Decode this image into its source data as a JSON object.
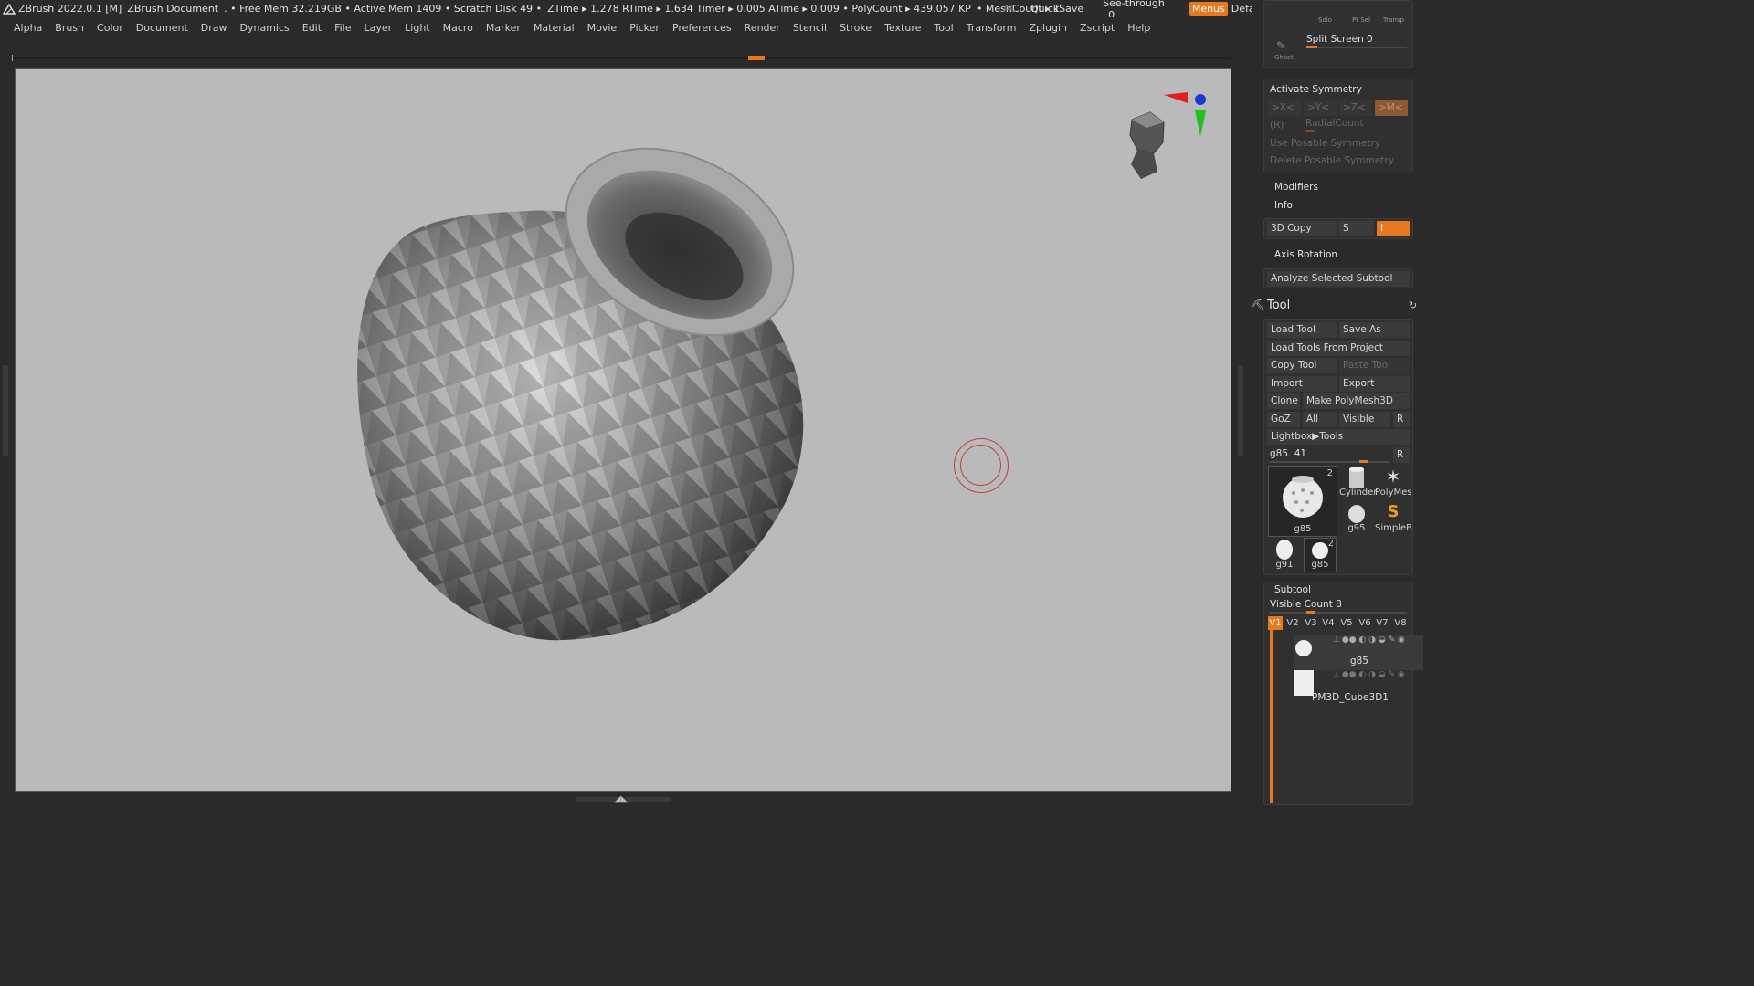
{
  "titlebar": {
    "app": "ZBrush 2022.0.1 [M]",
    "document": "ZBrush Document",
    "stats": [
      ". • Free Mem 32.219GB • Active Mem 1409 • Scratch Disk 49 •",
      "ZTime ▸ 1.278 RTime ▸ 1.634 Timer ▸ 0.005 ATime ▸ 0.009 • PolyCount ▸ 439.057 KP",
      "• MeshCount ▸ 1"
    ],
    "ac": "AC",
    "quicksave": "QuickSave",
    "see_through": "See-through",
    "see_through_value": "0",
    "menus": "Menus",
    "zscript": "DefaultZScript"
  },
  "menubar": [
    "Alpha",
    "Brush",
    "Color",
    "Document",
    "Draw",
    "Dynamics",
    "Edit",
    "File",
    "Layer",
    "Light",
    "Macro",
    "Marker",
    "Material",
    "Movie",
    "Picker",
    "Preferences",
    "Render",
    "Stencil",
    "Stroke",
    "Texture",
    "Tool",
    "Transform",
    "Zplugin",
    "Zscript",
    "Help"
  ],
  "colors": {
    "accent": "#e8781e",
    "canvas": "#bababa",
    "panel": "#2a2a2a"
  },
  "rpanel": {
    "top_icons": {
      "solo": "Solo",
      "ptsel": "Pt Sel",
      "transp": "Transp",
      "ghost": "Ghost"
    },
    "split_screen": "Split Screen 0",
    "symmetry": {
      "title": "Activate Symmetry",
      "x": ">X<",
      "y": ">Y<",
      "z": ">Z<",
      "m": ">M<",
      "r": "(R)",
      "radial": "RadialCount",
      "use_posable": "Use Posable Symmetry",
      "delete_posable": "Delete Posable Symmetry"
    },
    "modifiers": "Modifiers",
    "info": "Info",
    "copy3d": "3D Copy",
    "copy3d_s": "S",
    "copy3d_i": "I",
    "axis_rotation": "Axis Rotation",
    "analyze": "Analyze Selected Subtool",
    "tool": {
      "title": "Tool",
      "load": "Load Tool",
      "save_as": "Save As",
      "load_project": "Load Tools From Project",
      "copy": "Copy Tool",
      "paste": "Paste Tool",
      "import": "Import",
      "export": "Export",
      "clone": "Clone",
      "make_polymesh": "Make PolyMesh3D",
      "goz": "GoZ",
      "all": "All",
      "visible": "Visible",
      "r": "R",
      "lightbox": "Lightbox▶Tools",
      "current": "g85. 41",
      "current_r": "R",
      "thumbs": [
        {
          "name": "g85",
          "badge": "2"
        },
        {
          "name": "Cylinder"
        },
        {
          "name": "PolyMes"
        },
        {
          "name": "g95"
        },
        {
          "name": "SimpleB"
        },
        {
          "name": "g91"
        },
        {
          "name": "g85",
          "badge": "2"
        }
      ]
    },
    "subtool": {
      "title": "Subtool",
      "visible_count": "Visible Count 8",
      "tabs": [
        "V1",
        "V2",
        "V3",
        "V4",
        "V5",
        "V6",
        "V7",
        "V8"
      ],
      "items": [
        "g85",
        "PM3D_Cube3D1"
      ]
    }
  }
}
